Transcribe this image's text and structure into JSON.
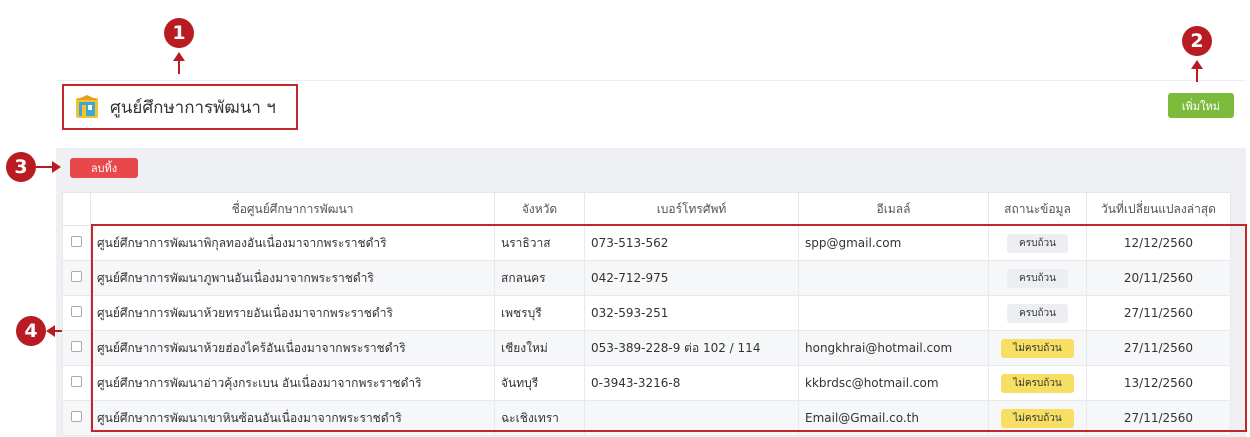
{
  "page": {
    "title": "ศูนย์ศึกษาการพัฒนา ฯ",
    "logo_icon": "building-icon",
    "add_button": "เพิ่มใหม่",
    "delete_button": "ลบทิ้ง"
  },
  "markers": [
    "1",
    "2",
    "3",
    "4"
  ],
  "colors": {
    "marker": "#b81c22",
    "add_button": "#7dbb3d",
    "delete_button": "#e8484a",
    "badge_incomplete": "#f7df64"
  },
  "table": {
    "headers": [
      "ชื่อศูนย์ศึกษาการพัฒนา",
      "จังหวัด",
      "เบอร์โทรศัพท์",
      "อีเมลล์",
      "สถานะข้อมูล",
      "วันที่เปลี่ยนแปลงล่าสุด"
    ],
    "rows": [
      {
        "name": "ศูนย์ศึกษาการพัฒนาพิกุลทองอันเนื่องมาจากพระราชดำริ",
        "province": "นราธิวาส",
        "phone": "073-513-562",
        "email": "spp@gmail.com",
        "status": "ครบถ้วน",
        "status_type": "ok",
        "date": "12/12/2560"
      },
      {
        "name": "ศูนย์ศึกษาการพัฒนาภูพานอันเนื่องมาจากพระราชดำริ",
        "province": "สกลนคร",
        "phone": "042-712-975",
        "email": "",
        "status": "ครบถ้วน",
        "status_type": "ok",
        "date": "20/11/2560"
      },
      {
        "name": "ศูนย์ศึกษาการพัฒนาห้วยทรายอันเนื่องมาจากพระราชดำริ",
        "province": "เพชรบุรี",
        "phone": "032-593-251",
        "email": "",
        "status": "ครบถ้วน",
        "status_type": "ok",
        "date": "27/11/2560"
      },
      {
        "name": "ศูนย์ศึกษาการพัฒนาห้วยฮ่องไคร้อันเนื่องมาจากพระราชดำริ",
        "province": "เชียงใหม่",
        "phone": "053-389-228-9 ต่อ 102 / 114",
        "email": "hongkhrai@hotmail.com",
        "status": "ไม่ครบถ้วน",
        "status_type": "bad",
        "date": "27/11/2560"
      },
      {
        "name": "ศูนย์ศึกษาการพัฒนาอ่าวคุ้งกระเบน อันเนื่องมาจากพระราชดำริ",
        "province": "จันทบุรี",
        "phone": "0-3943-3216-8",
        "email": "kkbrdsc@hotmail.com",
        "status": "ไม่ครบถ้วน",
        "status_type": "bad",
        "date": "13/12/2560"
      },
      {
        "name": "ศูนย์ศึกษาการพัฒนาเขาหินซ้อนอันเนื่องมาจากพระราชดำริ",
        "province": "ฉะเชิงเทรา",
        "phone": "",
        "email": "Email@Gmail.co.th",
        "status": "ไม่ครบถ้วน",
        "status_type": "bad",
        "date": "27/11/2560"
      }
    ]
  }
}
